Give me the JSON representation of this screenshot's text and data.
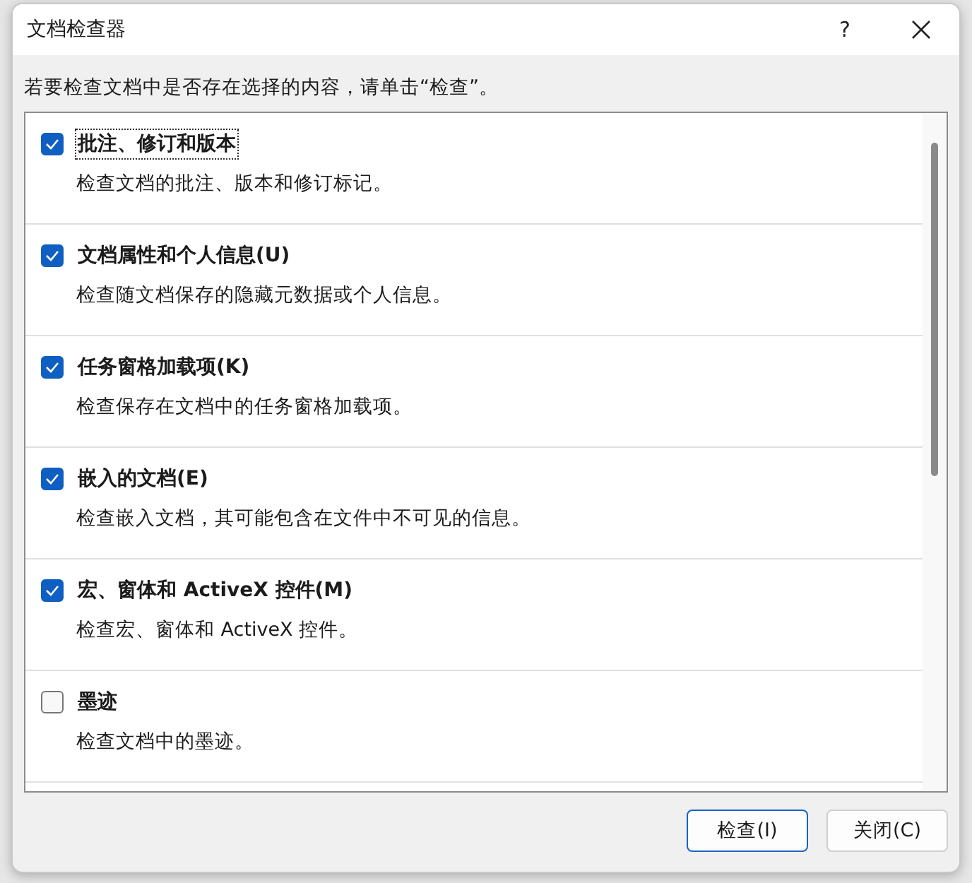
{
  "window": {
    "title": "文档检查器",
    "help": "?"
  },
  "instruction": "若要检查文档中是否存在选择的内容，请单击“检查”。",
  "items": [
    {
      "title": "批注、修订和版本",
      "description": "检查文档的批注、版本和修订标记。",
      "checked": true,
      "focused": true
    },
    {
      "title": "文档属性和个人信息(U)",
      "description": "检查随文档保存的隐藏元数据或个人信息。",
      "checked": true,
      "focused": false
    },
    {
      "title": "任务窗格加载项(K)",
      "description": "检查保存在文档中的任务窗格加载项。",
      "checked": true,
      "focused": false
    },
    {
      "title": "嵌入的文档(E)",
      "description": "检查嵌入文档，其可能包含在文件中不可见的信息。",
      "checked": true,
      "focused": false
    },
    {
      "title": "宏、窗体和 ActiveX 控件(M)",
      "description": "检查宏、窗体和 ActiveX 控件。",
      "checked": true,
      "focused": false
    },
    {
      "title": "墨迹",
      "description": "检查文档中的墨迹。",
      "checked": false,
      "focused": false
    }
  ],
  "buttons": [
    {
      "label": "检查(I)",
      "default": true
    },
    {
      "label": "关闭(C)",
      "default": false
    }
  ]
}
